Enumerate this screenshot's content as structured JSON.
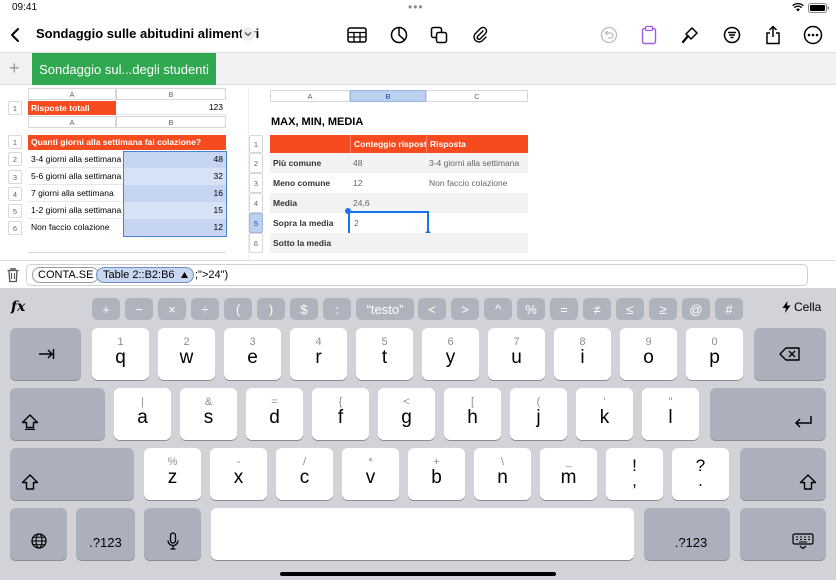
{
  "status": {
    "time": "09:41",
    "dots": "•••"
  },
  "toolbar": {
    "title": "Sondaggio sulle abitudini alimentari"
  },
  "sheets": {
    "active_tab": "Sondaggio sul...degli studenti",
    "add": "+"
  },
  "table1": {
    "cols": [
      "A",
      "B"
    ],
    "row_num": "1",
    "label": "Risposte totali",
    "value": "123"
  },
  "table2": {
    "cols": [
      "A",
      "B"
    ],
    "header": "Quanti giorni alla settimana fai colazione?",
    "rows": [
      {
        "n": "2",
        "label": "3-4 giorni alla settimana",
        "value": "48"
      },
      {
        "n": "3",
        "label": "5-6 giorni alla settimana",
        "value": "32"
      },
      {
        "n": "4",
        "label": "7 giorni alla settimana",
        "value": "16"
      },
      {
        "n": "5",
        "label": "1-2 giorni alla settimana",
        "value": "15"
      },
      {
        "n": "6",
        "label": "Non faccio colazione",
        "value": "12"
      }
    ],
    "row1": "1"
  },
  "table3": {
    "cols": [
      "A",
      "B",
      "C"
    ],
    "title": "MAX, MIN, MEDIA",
    "header": [
      "",
      "Conteggio risposte",
      "Risposta"
    ],
    "rows": [
      {
        "n": "1",
        "a": "",
        "b": "",
        "c": ""
      },
      {
        "n": "2",
        "a": "Più comune",
        "b": "48",
        "c": "3-4 giorni alla settimana"
      },
      {
        "n": "3",
        "a": "Meno comune",
        "b": "12",
        "c": "Non faccio colazione"
      },
      {
        "n": "4",
        "a": "Media",
        "b": "24,6",
        "c": ""
      },
      {
        "n": "5",
        "a": "Sopra la media",
        "b": "2",
        "c": ""
      },
      {
        "n": "6",
        "a": "Sotto la media",
        "b": "",
        "c": ""
      }
    ]
  },
  "formula": {
    "func": "CONTA.SE",
    "ref": "Table 2::B2:B6",
    "rest": ";\">24\")"
  },
  "fkeys": [
    "+",
    "−",
    "×",
    "÷",
    "(",
    ")",
    "$",
    ":",
    "“testo”",
    "<",
    ">",
    "^",
    "%",
    "=",
    "≠",
    "≤",
    "≥",
    "@",
    "#"
  ],
  "fx": "fx",
  "cella": "Cella",
  "keys": {
    "row1": [
      [
        "1",
        "q"
      ],
      [
        "2",
        "w"
      ],
      [
        "3",
        "e"
      ],
      [
        "4",
        "r"
      ],
      [
        "5",
        "t"
      ],
      [
        "6",
        "y"
      ],
      [
        "7",
        "u"
      ],
      [
        "8",
        "i"
      ],
      [
        "9",
        "o"
      ],
      [
        "0",
        "p"
      ]
    ],
    "row2": [
      [
        "|",
        "a"
      ],
      [
        "&",
        "s"
      ],
      [
        "=",
        "d"
      ],
      [
        "{",
        "f"
      ],
      [
        "<",
        "g"
      ],
      [
        "[",
        "h"
      ],
      [
        "(",
        "j"
      ],
      [
        "'",
        "k"
      ],
      [
        "\"",
        "l"
      ]
    ],
    "row3": [
      [
        "%",
        "z"
      ],
      [
        "-",
        "x"
      ],
      [
        "/",
        "c"
      ],
      [
        "*",
        "v"
      ],
      [
        "+",
        "b"
      ],
      [
        "\\",
        "n"
      ],
      [
        "_",
        "m"
      ],
      [
        "!",
        ","
      ],
      [
        "?",
        "."
      ]
    ],
    "num_left": ".?123",
    "num_right": ".?123"
  },
  "colors": {
    "accent": "#f54b1e",
    "sheet_tab": "#2fa84f",
    "selection": "#1a73e8"
  }
}
